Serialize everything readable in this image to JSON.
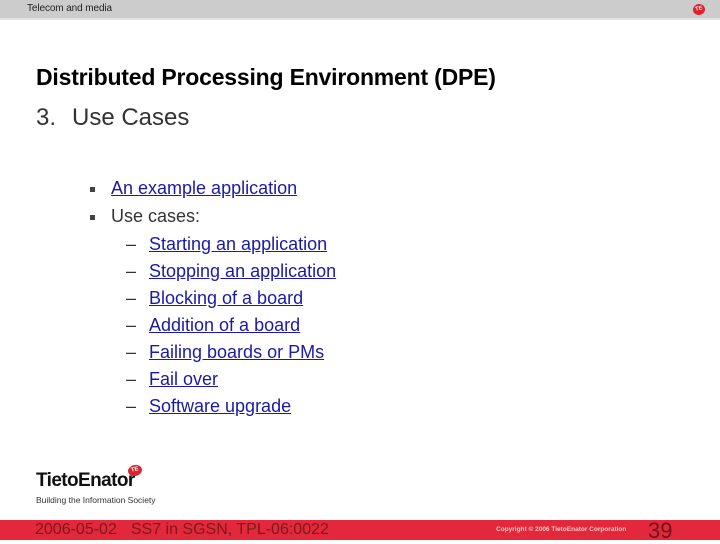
{
  "header": {
    "section_label": "Telecom and media",
    "badge_text": "TE"
  },
  "slide": {
    "title": "Distributed Processing Environment (DPE)",
    "subtitle_number": "3.",
    "subtitle_text": "Use Cases",
    "bullets": [
      {
        "level": 1,
        "text": "An example application",
        "link": true
      },
      {
        "level": 1,
        "text": "Use cases:",
        "link": false
      },
      {
        "level": 2,
        "text": "Starting an application",
        "link": true
      },
      {
        "level": 2,
        "text": "Stopping an application",
        "link": true
      },
      {
        "level": 2,
        "text": "Blocking of a board",
        "link": true
      },
      {
        "level": 2,
        "text": "Addition of a board",
        "link": true
      },
      {
        "level": 2,
        "text": "Failing boards or PMs",
        "link": true
      },
      {
        "level": 2,
        "text": "Fail over",
        "link": true
      },
      {
        "level": 2,
        "text": "Software upgrade",
        "link": true
      }
    ],
    "dash_marker": "–"
  },
  "logo": {
    "name": "TietoEnator",
    "badge_text": "TE",
    "tagline": "Building the Information Society"
  },
  "footer": {
    "date": "2006-05-02",
    "doc_ref": "SS7 in SGSN, TPL-06:0022",
    "copyright": "Copyright © 2006 TietoEnator Corporation",
    "page_number": "39"
  },
  "colors": {
    "header_bar": "#cccccc",
    "footer_bar": "#e2283a",
    "brand_red": "#d9232e",
    "link": "#1a1aa6"
  }
}
